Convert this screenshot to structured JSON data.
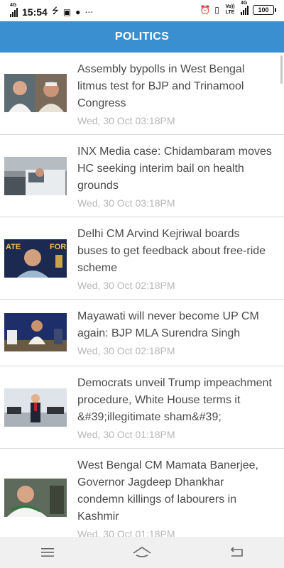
{
  "status_bar": {
    "network_left": "4G",
    "time": "15:54",
    "network_right": "Vo)) LTE",
    "network_right_gen": "4G",
    "battery": "100"
  },
  "header": {
    "title": "POLITICS"
  },
  "articles": [
    {
      "headline": "Assembly bypolls in West Bengal litmus test for BJP and Trinamool Congress",
      "timestamp": "Wed, 30 Oct 03:18PM"
    },
    {
      "headline": "INX Media case: Chidambaram moves HC seeking interim bail on health grounds",
      "timestamp": "Wed, 30 Oct 03:18PM"
    },
    {
      "headline": "Delhi CM Arvind Kejriwal boards buses to get feedback about free-ride scheme",
      "timestamp": "Wed, 30 Oct 02:18PM"
    },
    {
      "headline": "Mayawati will never become UP CM again: BJP MLA Surendra Singh",
      "timestamp": "Wed, 30 Oct 02:18PM"
    },
    {
      "headline": "Democrats unveil Trump impeachment procedure, White House terms it &#39;illegitimate sham&#39;",
      "timestamp": "Wed, 30 Oct 01:18PM"
    },
    {
      "headline": "West Bengal CM Mamata Banerjee, Governor Jagdeep Dhankhar condemn killings of labourers in Kashmir",
      "timestamp": "Wed, 30 Oct 01:18PM"
    }
  ],
  "icons": {
    "menu": "menu-icon",
    "home": "home-icon",
    "back": "back-icon"
  },
  "colors": {
    "header_bg": "#3a8fd0",
    "headline": "#4a4a4a",
    "timestamp": "#b7b7b7"
  }
}
